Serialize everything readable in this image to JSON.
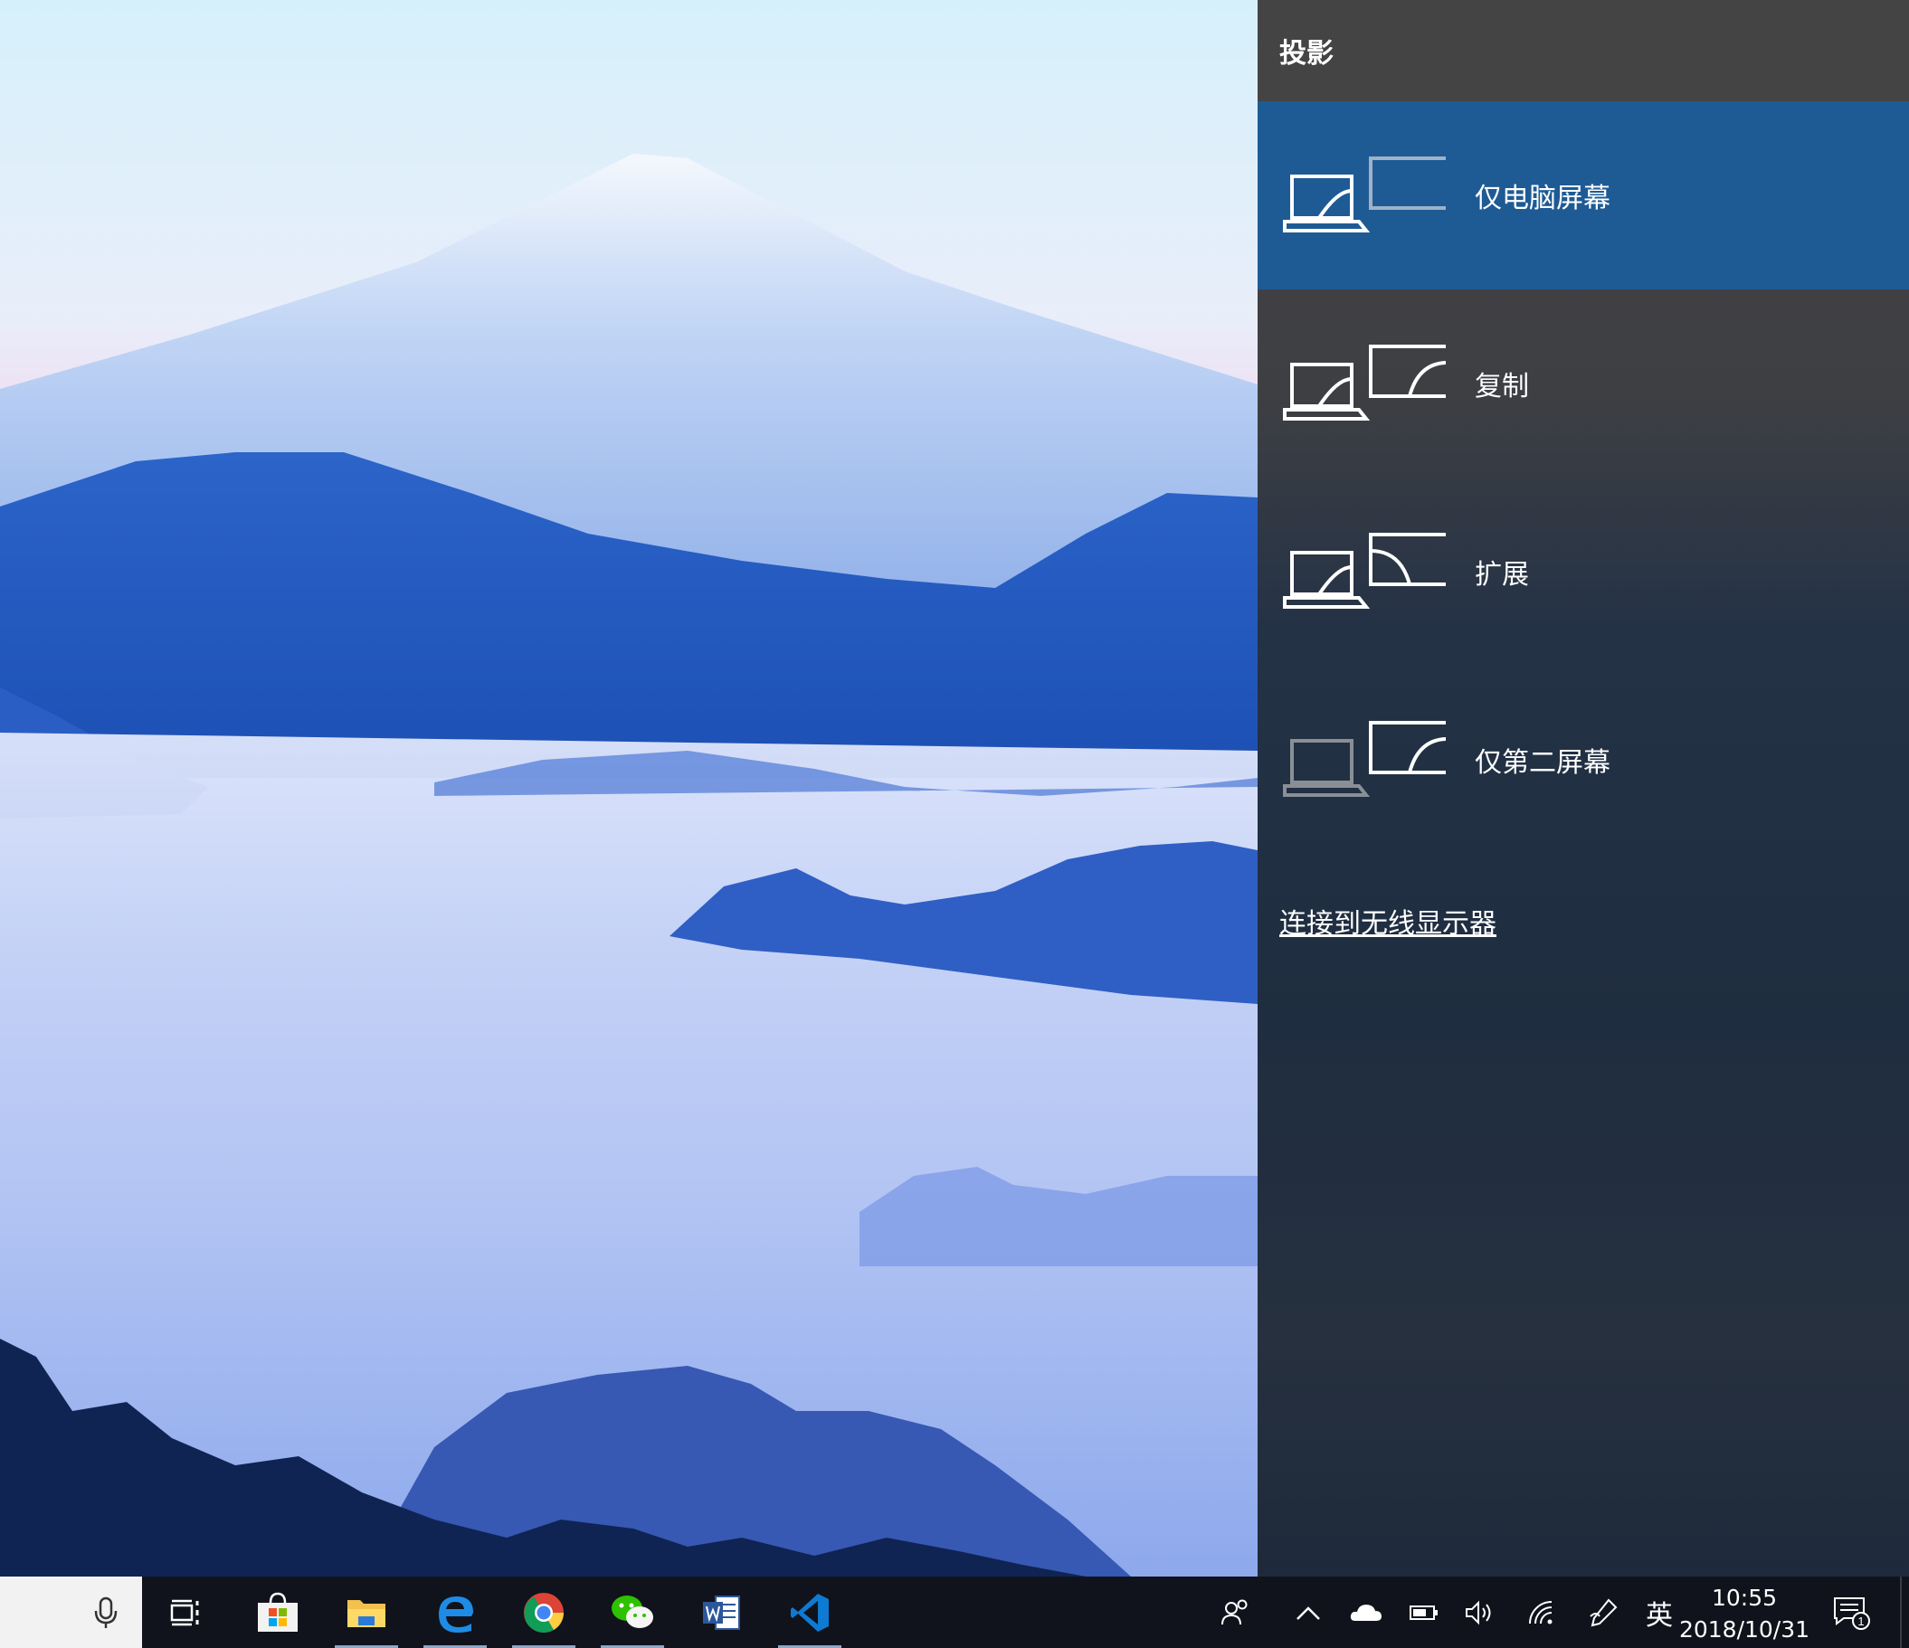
{
  "panel": {
    "title": "投影",
    "options": [
      {
        "label": "仅电脑屏幕",
        "selected": true
      },
      {
        "label": "复制",
        "selected": false
      },
      {
        "label": "扩展",
        "selected": false
      },
      {
        "label": "仅第二屏幕",
        "selected": false
      }
    ],
    "wireless_link": "连接到无线显示器",
    "accent_color": "#1e5b95"
  },
  "taskbar": {
    "pinned": [
      "search-box",
      "task-view-icon",
      "store-icon",
      "file-explorer-icon",
      "edge-icon",
      "chrome-icon",
      "wechat-icon",
      "word-icon",
      "vscode-icon"
    ],
    "ime": "英",
    "time": "10:55",
    "date": "2018/10/31",
    "notification_count": "1"
  }
}
